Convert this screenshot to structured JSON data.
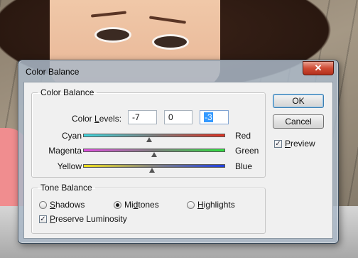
{
  "window": {
    "title": "Color Balance",
    "close_glyph": "✕"
  },
  "color_balance": {
    "legend": "Color Balance",
    "levels_label_prefix": "Color ",
    "levels_label_accel": "L",
    "levels_label_suffix": "evels:",
    "levels": [
      "-7",
      "0",
      "-3"
    ],
    "sliders": [
      {
        "left": "Cyan",
        "right": "Red",
        "value": -7,
        "min": -100,
        "max": 100,
        "colors": [
          "#40d8e0",
          "#e03020"
        ]
      },
      {
        "left": "Magenta",
        "right": "Green",
        "value": 0,
        "min": -100,
        "max": 100,
        "colors": [
          "#e050e0",
          "#30e040"
        ]
      },
      {
        "left": "Yellow",
        "right": "Blue",
        "value": -3,
        "min": -100,
        "max": 100,
        "colors": [
          "#f0e020",
          "#2040e0"
        ]
      }
    ]
  },
  "tone_balance": {
    "legend": "Tone Balance",
    "options": [
      {
        "accel": "S",
        "rest": "hadows",
        "selected": false
      },
      {
        "pre": "Mi",
        "accel": "d",
        "rest": "tones",
        "selected": true
      },
      {
        "accel": "H",
        "rest": "ighlights",
        "selected": false
      }
    ],
    "preserve_luminosity": {
      "pre": "",
      "accel": "P",
      "rest": "reserve Luminosity",
      "checked": true
    }
  },
  "buttons": {
    "ok": "OK",
    "cancel": "Cancel"
  },
  "preview": {
    "accel": "P",
    "rest": "review",
    "checked": true
  },
  "colors": {
    "ok_focus_border": "#3c7fb1",
    "selection": "#3399ff",
    "close_button": "#cf4b34"
  }
}
